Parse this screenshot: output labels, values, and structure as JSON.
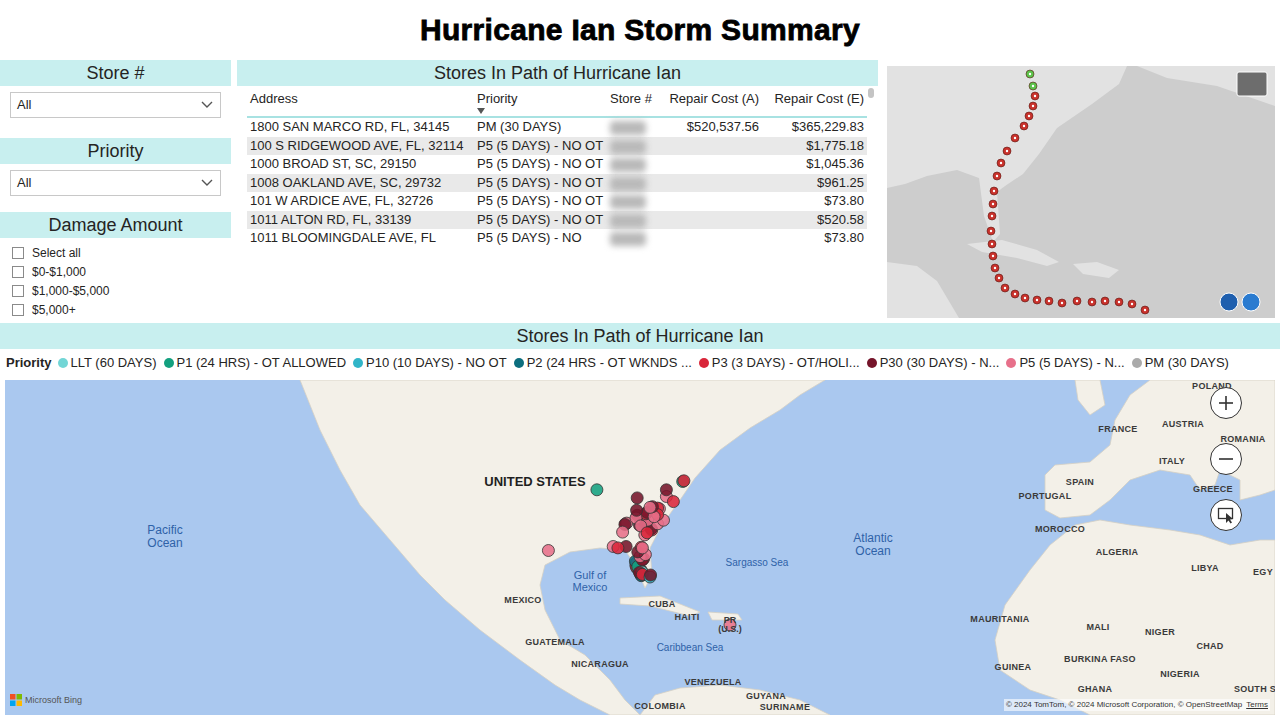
{
  "title": "Hurricane Ian Storm Summary",
  "filters": {
    "store": {
      "label": "Store #",
      "value": "All"
    },
    "priority": {
      "label": "Priority",
      "value": "All"
    },
    "damage": {
      "label": "Damage Amount",
      "options": [
        {
          "label": "Select all",
          "checked": false
        },
        {
          "label": "$0-$1,000",
          "checked": false
        },
        {
          "label": "$1,000-$5,000",
          "checked": false
        },
        {
          "label": "$5,000+",
          "checked": false
        }
      ]
    }
  },
  "table": {
    "title": "Stores In Path of Hurricane Ian",
    "columns": [
      {
        "label": "Address",
        "sorted": false
      },
      {
        "label": "Priority",
        "sorted": true
      },
      {
        "label": "Store #",
        "sorted": false
      },
      {
        "label": "Repair Cost (A)",
        "sorted": false
      },
      {
        "label": "Repair Cost (E)",
        "sorted": false
      }
    ],
    "rows": [
      {
        "address": "1800 SAN MARCO RD, FL, 34145",
        "priority": "PM (30 DAYS)",
        "store_blurred": true,
        "cost_a": "$520,537.56",
        "cost_e": "$365,229.83"
      },
      {
        "address": "100 S RIDGEWOOD AVE, FL, 32114",
        "priority": "P5 (5 DAYS) - NO OT",
        "store_blurred": true,
        "cost_a": "",
        "cost_e": "$1,775.18"
      },
      {
        "address": "1000 BROAD ST, SC, 29150",
        "priority": "P5 (5 DAYS) - NO OT",
        "store_blurred": true,
        "cost_a": "",
        "cost_e": "$1,045.36"
      },
      {
        "address": "1008 OAKLAND AVE, SC, 29732",
        "priority": "P5 (5 DAYS) - NO OT",
        "store_blurred": true,
        "cost_a": "",
        "cost_e": "$961.25"
      },
      {
        "address": "101 W ARDICE AVE, FL, 32726",
        "priority": "P5 (5 DAYS) - NO OT",
        "store_blurred": true,
        "cost_a": "",
        "cost_e": "$73.80"
      },
      {
        "address": "1011 ALTON RD, FL, 33139",
        "priority": "P5 (5 DAYS) - NO OT",
        "store_blurred": true,
        "cost_a": "",
        "cost_e": "$520.58"
      },
      {
        "address": "1011 BLOOMINGDALE AVE, FL",
        "priority": "P5 (5 DAYS) - NO",
        "store_blurred": true,
        "cost_a": "",
        "cost_e": "$73.80"
      }
    ]
  },
  "map": {
    "title": "Stores In Path of Hurricane Ian",
    "legend_title": "Priority",
    "legend": [
      {
        "label": "LLT (60 DAYS)",
        "color": "#72d6d6"
      },
      {
        "label": "P1 (24 HRS) - OT ALLOWED",
        "color": "#13a07f"
      },
      {
        "label": "P10 (10 DAYS) - NO OT",
        "color": "#31b5c8"
      },
      {
        "label": "P2 (24 HRS - OT WKNDS ...",
        "color": "#0c6e7e"
      },
      {
        "label": "P3 (3 DAYS) - OT/HOLI...",
        "color": "#d9263a"
      },
      {
        "label": "P30 (30 DAYS) - N...",
        "color": "#75142a"
      },
      {
        "label": "P5 (5 DAYS) - N...",
        "color": "#e7708a"
      },
      {
        "label": "PM (30 DAYS)",
        "color": "#aaaaaa"
      }
    ],
    "labels": [
      {
        "text": "UNITED STATES",
        "kind": "major"
      },
      {
        "text": "Pacific Ocean",
        "kind": "water"
      },
      {
        "text": "Atlantic Ocean",
        "kind": "water"
      },
      {
        "text": "Gulf of Mexico",
        "kind": "gulf"
      },
      {
        "text": "Sargasso Sea",
        "kind": "sea"
      },
      {
        "text": "MEXICO",
        "kind": "country"
      },
      {
        "text": "CUBA",
        "kind": "country"
      },
      {
        "text": "HAITI",
        "kind": "country"
      },
      {
        "text": "PR (U.S.)",
        "kind": "island"
      },
      {
        "text": "Caribbean Sea",
        "kind": "sea"
      },
      {
        "text": "GUATEMALA",
        "kind": "country"
      },
      {
        "text": "NICARAGUA",
        "kind": "country"
      },
      {
        "text": "VENEZUELA",
        "kind": "country"
      },
      {
        "text": "GUYANA",
        "kind": "country"
      },
      {
        "text": "SURINAME",
        "kind": "country"
      },
      {
        "text": "COLOMBIA",
        "kind": "country"
      },
      {
        "text": "FRANCE",
        "kind": "country"
      },
      {
        "text": "AUSTRIA",
        "kind": "country"
      },
      {
        "text": "ROMANIA",
        "kind": "country"
      },
      {
        "text": "ITALY",
        "kind": "country"
      },
      {
        "text": "GREECE",
        "kind": "country"
      },
      {
        "text": "PORTUGAL",
        "kind": "country"
      },
      {
        "text": "SPAIN",
        "kind": "country"
      },
      {
        "text": "MOROCCO",
        "kind": "country"
      },
      {
        "text": "ALGERIA",
        "kind": "country"
      },
      {
        "text": "LIBYA",
        "kind": "country"
      },
      {
        "text": "EGY",
        "kind": "country"
      },
      {
        "text": "MAURITANIA",
        "kind": "country"
      },
      {
        "text": "MALI",
        "kind": "country"
      },
      {
        "text": "NIGER",
        "kind": "country"
      },
      {
        "text": "CHAD",
        "kind": "country"
      },
      {
        "text": "BURKINA FASO",
        "kind": "country"
      },
      {
        "text": "NIGERIA",
        "kind": "country"
      },
      {
        "text": "GUINEA",
        "kind": "country"
      },
      {
        "text": "GHANA",
        "kind": "country"
      },
      {
        "text": "SOUTH S",
        "kind": "country"
      },
      {
        "text": "POLAND",
        "kind": "country"
      }
    ],
    "points": [
      {
        "lat": 26.6,
        "lon": -81.9,
        "priority": 3
      },
      {
        "lat": 26.7,
        "lon": -81.8,
        "priority": 1
      },
      {
        "lat": 26.5,
        "lon": -81.8,
        "priority": 2
      },
      {
        "lat": 26.4,
        "lon": -81.9,
        "priority": 4
      },
      {
        "lat": 26.1,
        "lon": -81.7,
        "priority": 0
      },
      {
        "lat": 26.2,
        "lon": -81.8,
        "priority": 5
      },
      {
        "lat": 26.9,
        "lon": -82.0,
        "priority": 6
      },
      {
        "lat": 27.0,
        "lon": -82.2,
        "priority": 3
      },
      {
        "lat": 27.1,
        "lon": -82.4,
        "priority": 2
      },
      {
        "lat": 27.3,
        "lon": -82.5,
        "priority": 4
      },
      {
        "lat": 26.3,
        "lon": -81.6,
        "priority": 1
      },
      {
        "lat": 26.8,
        "lon": -81.7,
        "priority": 5
      },
      {
        "lat": 26.0,
        "lon": -81.7,
        "priority": 3
      },
      {
        "lat": 27.5,
        "lon": -82.6,
        "priority": 6
      },
      {
        "lat": 27.7,
        "lon": -82.6,
        "priority": 4
      },
      {
        "lat": 27.9,
        "lon": -82.4,
        "priority": 5
      },
      {
        "lat": 28.0,
        "lon": -82.5,
        "priority": 6
      },
      {
        "lat": 28.2,
        "lon": -82.7,
        "priority": 3
      },
      {
        "lat": 27.4,
        "lon": -82.3,
        "priority": 1
      },
      {
        "lat": 26.6,
        "lon": -81.6,
        "priority": 0
      },
      {
        "lat": 26.5,
        "lon": -82.0,
        "priority": 5
      },
      {
        "lat": 26.2,
        "lon": -81.5,
        "priority": 4
      },
      {
        "lat": 28.5,
        "lon": -81.4,
        "priority": 6
      },
      {
        "lat": 28.6,
        "lon": -81.3,
        "priority": 4
      },
      {
        "lat": 28.4,
        "lon": -81.5,
        "priority": 5
      },
      {
        "lat": 28.9,
        "lon": -81.9,
        "priority": 6
      },
      {
        "lat": 29.2,
        "lon": -81.0,
        "priority": 6
      },
      {
        "lat": 29.6,
        "lon": -82.3,
        "priority": 5
      },
      {
        "lat": 30.3,
        "lon": -81.7,
        "priority": 4
      },
      {
        "lat": 30.2,
        "lon": -81.5,
        "priority": 6
      },
      {
        "lat": 30.4,
        "lon": -84.3,
        "priority": 5
      },
      {
        "lat": 30.4,
        "lon": -86.5,
        "priority": 6
      },
      {
        "lat": 25.8,
        "lon": -80.2,
        "priority": 2
      },
      {
        "lat": 26.1,
        "lon": -80.1,
        "priority": 5
      },
      {
        "lat": 30.2,
        "lon": -85.7,
        "priority": 4
      },
      {
        "lat": 32.1,
        "lon": -81.1,
        "priority": 6
      },
      {
        "lat": 32.8,
        "lon": -79.9,
        "priority": 4
      },
      {
        "lat": 33.0,
        "lon": -80.0,
        "priority": 5
      },
      {
        "lat": 33.7,
        "lon": -78.9,
        "priority": 6
      },
      {
        "lat": 34.0,
        "lon": -81.0,
        "priority": 4
      },
      {
        "lat": 34.1,
        "lon": -80.9,
        "priority": 6
      },
      {
        "lat": 33.9,
        "lon": -81.2,
        "priority": 5
      },
      {
        "lat": 34.2,
        "lon": -80.6,
        "priority": 6
      },
      {
        "lat": 34.9,
        "lon": -82.4,
        "priority": 5
      },
      {
        "lat": 35.2,
        "lon": -80.8,
        "priority": 6
      },
      {
        "lat": 35.1,
        "lon": -80.9,
        "priority": 4
      },
      {
        "lat": 35.3,
        "lon": -80.7,
        "priority": 5
      },
      {
        "lat": 35.8,
        "lon": -78.6,
        "priority": 6
      },
      {
        "lat": 35.9,
        "lon": -78.9,
        "priority": 4
      },
      {
        "lat": 34.2,
        "lon": -77.9,
        "priority": 6
      },
      {
        "lat": 33.5,
        "lon": -82.0,
        "priority": 5
      },
      {
        "lat": 33.7,
        "lon": -84.4,
        "priority": 4
      },
      {
        "lat": 33.8,
        "lon": -84.2,
        "priority": 6
      },
      {
        "lat": 33.6,
        "lon": -84.5,
        "priority": 5
      },
      {
        "lat": 32.5,
        "lon": -84.9,
        "priority": 6
      },
      {
        "lat": 34.5,
        "lon": -82.6,
        "priority": 6
      },
      {
        "lat": 35.6,
        "lon": -82.5,
        "priority": 5
      },
      {
        "lat": 35.0,
        "lon": -78.9,
        "priority": 4
      },
      {
        "lat": 34.7,
        "lon": -79.5,
        "priority": 6
      },
      {
        "lat": 33.4,
        "lon": -81.8,
        "priority": 6
      },
      {
        "lat": 32.4,
        "lon": -80.7,
        "priority": 4
      },
      {
        "lat": 36.1,
        "lon": -79.8,
        "priority": 5
      },
      {
        "lat": 36.0,
        "lon": -80.2,
        "priority": 6
      },
      {
        "lat": 37.3,
        "lon": -82.4,
        "priority": 5
      },
      {
        "lat": 37.5,
        "lon": -77.4,
        "priority": 6
      },
      {
        "lat": 38.4,
        "lon": -77.4,
        "priority": 5
      },
      {
        "lat": 39.5,
        "lon": -74.6,
        "priority": 1
      },
      {
        "lat": 39.6,
        "lon": -74.4,
        "priority": 4
      },
      {
        "lat": 36.8,
        "lon": -76.2,
        "priority": 4
      },
      {
        "lat": 38.4,
        "lon": -89.3,
        "priority": 1
      },
      {
        "lat": 29.8,
        "lon": -97.6,
        "priority": 6
      },
      {
        "lat": 18.2,
        "lon": -66.5,
        "priority": 6
      }
    ],
    "brand": "Microsoft Bing",
    "attribution": "© 2024 TomTom, © 2024 Microsoft Corporation, © OpenStreetMap",
    "terms": "Terms"
  }
}
